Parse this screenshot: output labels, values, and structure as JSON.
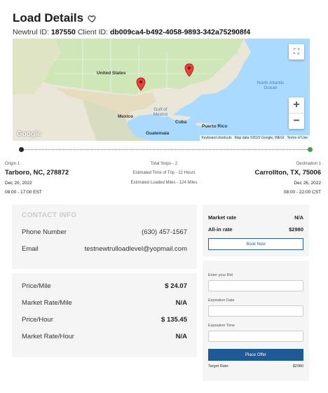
{
  "header": {
    "title": "Load Details",
    "newtrul_id_label": "Newtrul ID:",
    "newtrul_id": "187550",
    "client_id_label": "Client ID:",
    "client_id": "db009ca4-b492-4058-9893-342a752908f4"
  },
  "map": {
    "labels": {
      "united_states": "United States",
      "mexico": "Mexico",
      "gulf": "Gulf of Mexico",
      "cuba": "Cuba",
      "puerto_rico": "Puerto Rico",
      "guatemala": "Guatemala",
      "atlantic": "North Atlantic Ocean"
    },
    "google": "Google",
    "attribution": [
      "Keyboard shortcuts",
      "Map data ©2022 Google, INEGI",
      "Terms of Use"
    ],
    "zoom_in": "+",
    "zoom_out": "−",
    "fullscreen": "⛶"
  },
  "route": {
    "origin_label": "Origin 1",
    "origin_city": "Tarboro, NC, 278872",
    "origin_date": "Dec 20, 2022",
    "origin_time": "08:00 - 17:00 EST",
    "total_stops": "Total Stops - 2",
    "est_time": "Estimated Time of Trip - 22 Hours",
    "est_miles": "Estimated Loaded Miles - 124 Miles",
    "dest_label": "Destination 1",
    "dest_city": "Carrollton, TX, 75006",
    "dest_date": "Dec 26, 2022",
    "dest_time": "08:00 - 22:00 CST"
  },
  "contact": {
    "heading": "CONTACT INFO",
    "phone_label": "Phone Number",
    "phone": "(630) 457-1567",
    "email_label": "Email",
    "email": "testnewtrulloadlevel@yopmail.com"
  },
  "prices": {
    "price_mile_label": "Price/Mile",
    "price_mile": "$ 24.07",
    "market_mile_label": "Market Rate/Mile",
    "market_mile": "N/A",
    "price_hour_label": "Price/Hour",
    "price_hour": "$ 135.45",
    "market_hour_label": "Market Rate/Hour",
    "market_hour": "N/A"
  },
  "rate": {
    "market_label": "Market rate",
    "market_value": "N/A",
    "allin_label": "All-in rate",
    "allin_value": "$2980",
    "book_now": "Book Now"
  },
  "bid": {
    "enter_bid": "Enter your Bid",
    "expiration_date": "Expiration Date",
    "expiration_time": "Expiration Time",
    "place_offer": "Place Offer",
    "target_label": "Target Rate:",
    "target_value": "$2980"
  },
  "colors": {
    "primary": "#1e5a96",
    "origin_dot": "#1b2a3a",
    "dest_dot": "#3fa34d",
    "pin": "#e8413a"
  }
}
